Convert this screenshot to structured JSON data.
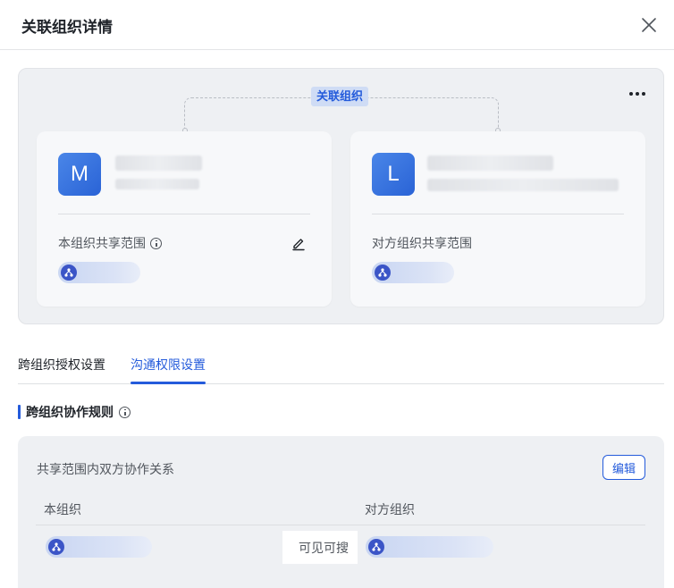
{
  "dialog": {
    "title": "关联组织详情",
    "close_icon": "close-icon"
  },
  "relation": {
    "badge": "关联组织",
    "more_icon": "more-horizontal-icon",
    "own_org": {
      "avatar_letter": "M",
      "scope_label": "本组织共享范围",
      "info_icon": "info-icon",
      "edit_icon": "edit-icon"
    },
    "peer_org": {
      "avatar_letter": "L",
      "scope_label": "对方组织共享范围"
    },
    "scope_chip_icon": "org-structure-icon"
  },
  "tabs": [
    {
      "label": "跨组织授权设置",
      "active": false
    },
    {
      "label": "沟通权限设置",
      "active": true
    }
  ],
  "section": {
    "title": "跨组织协作规则",
    "info_icon": "info-icon"
  },
  "rules": {
    "heading": "共享范围内双方协作关系",
    "edit_label": "编辑",
    "columns": [
      "本组织",
      "对方组织"
    ],
    "rows": [
      {
        "permission": "可见可搜"
      }
    ]
  },
  "colors": {
    "accent": "#245bdb",
    "panel_bg": "#eef0f3",
    "card_bg": "#f7f8fa",
    "avatar": "#2a63d6"
  }
}
